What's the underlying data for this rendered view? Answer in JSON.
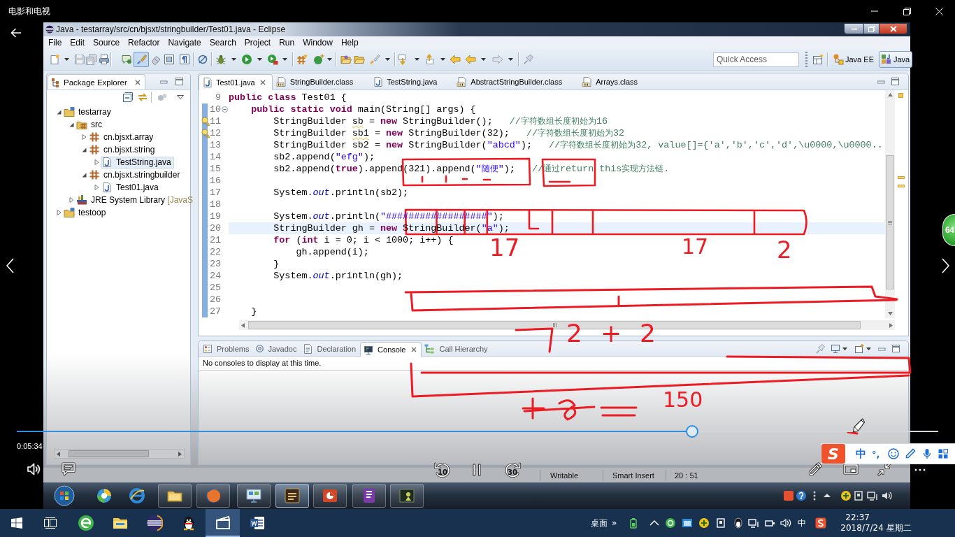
{
  "app": {
    "title": "电影和电视"
  },
  "eclipse": {
    "title": "Java - testarray/src/cn/bjsxt/stringbuilder/Test01.java - Eclipse",
    "menu": [
      "File",
      "Edit",
      "Source",
      "Refactor",
      "Navigate",
      "Search",
      "Project",
      "Run",
      "Window",
      "Help"
    ],
    "toolbar": {
      "toggle": {
        "pressed": true
      },
      "quick_access": {
        "placeholder": "Quick Access"
      },
      "perspectives": [
        {
          "label": "Java EE",
          "selected": false
        },
        {
          "label": "Java",
          "selected": true
        }
      ]
    },
    "package_explorer": {
      "title": "Package Explorer",
      "tree": [
        {
          "label": "testarray",
          "kind": "project",
          "expanded": true,
          "selected": false,
          "children": [
            {
              "label": "src",
              "kind": "source",
              "expanded": true,
              "selected": false,
              "children": [
                {
                  "label": "cn.bjsxt.array",
                  "kind": "package",
                  "expanded": false,
                  "selected": false
                },
                {
                  "label": "cn.bjsxt.string",
                  "kind": "package",
                  "expanded": true,
                  "selected": false,
                  "children": [
                    {
                      "label": "TestString.java",
                      "kind": "java",
                      "expanded": false,
                      "selected": true
                    }
                  ]
                },
                {
                  "label": "cn.bjsxt.stringbuilder",
                  "kind": "package",
                  "expanded": true,
                  "selected": false,
                  "children": [
                    {
                      "label": "Test01.java",
                      "kind": "java",
                      "expanded": false,
                      "selected": false
                    }
                  ]
                }
              ]
            },
            {
              "label": "JRE System Library",
              "note": "[JavaS",
              "kind": "library",
              "expanded": false,
              "selected": false
            }
          ]
        },
        {
          "label": "testoop",
          "kind": "project",
          "expanded": false,
          "selected": false
        }
      ]
    },
    "editor": {
      "tabs": [
        {
          "label": "Test01.java",
          "kind": "java",
          "selected": true
        },
        {
          "label": "StringBuilder.class",
          "kind": "class",
          "selected": false
        },
        {
          "label": "TestString.java",
          "kind": "java",
          "selected": false
        },
        {
          "label": "AbstractStringBuilder.class",
          "kind": "class",
          "selected": false
        },
        {
          "label": "Arrays.class",
          "kind": "class",
          "selected": false
        }
      ],
      "lines": [
        {
          "number": "9",
          "in_range": false,
          "warning": false,
          "fold_marker": false,
          "current": false,
          "code": [
            {
              "kind": "keyword",
              "text": "public class"
            },
            {
              "kind": "plain",
              "text": " Test01 {"
            }
          ]
        },
        {
          "number": "10",
          "in_range": true,
          "warning": false,
          "fold_marker": true,
          "current": false,
          "code": [
            {
              "kind": "keyword",
              "text": "    public static void"
            },
            {
              "kind": "plain",
              "text": " main(String[] args) {"
            }
          ]
        },
        {
          "number": "11",
          "in_range": true,
          "warning": true,
          "fold_marker": false,
          "current": false,
          "code": [
            {
              "kind": "plain",
              "text": "        StringBuilder "
            },
            {
              "kind": "unused",
              "text": "sb"
            },
            {
              "kind": "plain",
              "text": " = "
            },
            {
              "kind": "keyword",
              "text": "new"
            },
            {
              "kind": "plain",
              "text": " StringBuilder();   "
            },
            {
              "kind": "comment",
              "text": "//字符数组长度初始为16"
            }
          ]
        },
        {
          "number": "12",
          "in_range": true,
          "warning": true,
          "fold_marker": false,
          "current": false,
          "code": [
            {
              "kind": "plain",
              "text": "        StringBuilder "
            },
            {
              "kind": "unused",
              "text": "sb1"
            },
            {
              "kind": "plain",
              "text": " = "
            },
            {
              "kind": "keyword",
              "text": "new"
            },
            {
              "kind": "plain",
              "text": " StringBuilder(32);   "
            },
            {
              "kind": "comment",
              "text": "//字符数组长度初始为32"
            }
          ]
        },
        {
          "number": "13",
          "in_range": true,
          "warning": false,
          "fold_marker": false,
          "current": false,
          "code": [
            {
              "kind": "plain",
              "text": "        StringBuilder sb2 = "
            },
            {
              "kind": "keyword",
              "text": "new"
            },
            {
              "kind": "plain",
              "text": " StringBuilder("
            },
            {
              "kind": "string",
              "text": "\"abcd\""
            },
            {
              "kind": "plain",
              "text": ");   "
            },
            {
              "kind": "comment",
              "text": "//字符数组长度初始为32, value[]={'a','b','c','d',\\u0000,\\u0000.."
            }
          ]
        },
        {
          "number": "14",
          "in_range": true,
          "warning": false,
          "fold_marker": false,
          "current": false,
          "code": [
            {
              "kind": "plain",
              "text": "        sb2.append("
            },
            {
              "kind": "string",
              "text": "\"efg\""
            },
            {
              "kind": "plain",
              "text": ");"
            }
          ]
        },
        {
          "number": "15",
          "in_range": true,
          "warning": false,
          "fold_marker": false,
          "current": false,
          "code": [
            {
              "kind": "plain",
              "text": "        sb2.append("
            },
            {
              "kind": "keyword",
              "text": "true"
            },
            {
              "kind": "plain",
              "text": ").append(321).append("
            },
            {
              "kind": "string",
              "text": "\"随便\""
            },
            {
              "kind": "plain",
              "text": ");   "
            },
            {
              "kind": "comment",
              "text": "//通过return this实现方法链."
            }
          ]
        },
        {
          "number": "16",
          "in_range": true,
          "warning": false,
          "fold_marker": false,
          "current": false
        },
        {
          "number": "17",
          "in_range": true,
          "warning": false,
          "fold_marker": false,
          "current": false,
          "code": [
            {
              "kind": "plain",
              "text": "        System."
            },
            {
              "kind": "static_field",
              "text": "out"
            },
            {
              "kind": "plain",
              "text": ".println(sb2);"
            }
          ]
        },
        {
          "number": "18",
          "in_range": true,
          "warning": false,
          "fold_marker": false,
          "current": false
        },
        {
          "number": "19",
          "in_range": true,
          "warning": false,
          "fold_marker": false,
          "current": false,
          "code": [
            {
              "kind": "plain",
              "text": "        System."
            },
            {
              "kind": "static_field",
              "text": "out"
            },
            {
              "kind": "plain",
              "text": ".println("
            },
            {
              "kind": "string",
              "text": "\"##################\""
            },
            {
              "kind": "plain",
              "text": ");"
            }
          ]
        },
        {
          "number": "20",
          "in_range": true,
          "warning": false,
          "fold_marker": false,
          "current": true,
          "code": [
            {
              "kind": "plain",
              "text": "        StringBuilder gh = "
            },
            {
              "kind": "keyword",
              "text": "new"
            },
            {
              "kind": "plain",
              "text": " StringBuilder("
            },
            {
              "kind": "string",
              "text": "\"a\""
            },
            {
              "kind": "plain",
              "text": ");"
            }
          ]
        },
        {
          "number": "21",
          "in_range": true,
          "warning": false,
          "fold_marker": false,
          "current": false,
          "code": [
            {
              "kind": "keyword",
              "text": "        for"
            },
            {
              "kind": "plain",
              "text": " ("
            },
            {
              "kind": "keyword",
              "text": "int"
            },
            {
              "kind": "plain",
              "text": " i = 0; i < 1000; i++) {"
            }
          ]
        },
        {
          "number": "22",
          "in_range": true,
          "warning": false,
          "fold_marker": false,
          "current": false,
          "code": [
            {
              "kind": "plain",
              "text": "            gh.append(i);"
            }
          ]
        },
        {
          "number": "23",
          "in_range": true,
          "warning": false,
          "fold_marker": false,
          "current": false,
          "code": [
            {
              "kind": "plain",
              "text": "        }"
            }
          ]
        },
        {
          "number": "24",
          "in_range": true,
          "warning": false,
          "fold_marker": false,
          "current": false,
          "code": [
            {
              "kind": "plain",
              "text": "        System."
            },
            {
              "kind": "static_field",
              "text": "out"
            },
            {
              "kind": "plain",
              "text": ".println(gh);"
            }
          ]
        },
        {
          "number": "25",
          "in_range": true,
          "warning": false,
          "fold_marker": false,
          "current": false
        },
        {
          "number": "26",
          "in_range": true,
          "warning": false,
          "fold_marker": false,
          "current": false
        },
        {
          "number": "27",
          "in_range": true,
          "warning": false,
          "fold_marker": false,
          "current": false,
          "code": [
            {
              "kind": "plain",
              "text": "    }"
            }
          ]
        }
      ]
    },
    "console": {
      "tabs": [
        {
          "label": "Problems",
          "kind": "problems",
          "selected": false
        },
        {
          "label": "Javadoc",
          "kind": "javadoc",
          "selected": false
        },
        {
          "label": "Declaration",
          "kind": "declaration",
          "selected": false
        },
        {
          "label": "Console",
          "kind": "console",
          "selected": true
        },
        {
          "label": "Call Hierarchy",
          "kind": "hierarchy",
          "selected": false
        }
      ],
      "message": "No consoles to display at this time."
    },
    "status_bar": [
      "Writable",
      "Smart Insert",
      "20 : 51"
    ]
  },
  "recorded_taskbar": {
    "apps": [
      {
        "kind": "safeguard",
        "running": false,
        "selected": false
      },
      {
        "kind": "ie",
        "running": false,
        "selected": false
      },
      {
        "kind": "explorer",
        "running": true,
        "selected": false
      },
      {
        "kind": "firefox",
        "running": true,
        "selected": false
      },
      {
        "kind": "remote",
        "running": true,
        "selected": false
      },
      {
        "kind": "javaee",
        "running": true,
        "selected": true
      },
      {
        "kind": "powerpoint",
        "running": true,
        "selected": false
      },
      {
        "kind": "onenote",
        "running": true,
        "selected": false
      },
      {
        "kind": "tool",
        "running": true,
        "selected": false
      }
    ]
  },
  "annotations": [
    {
      "text": "17"
    },
    {
      "text": "17"
    },
    {
      "text": "2"
    },
    {
      "text": "2+2"
    },
    {
      "text": "150"
    }
  ],
  "player": {
    "playing": true,
    "progress": {
      "level": 0.733
    },
    "elapsed": "0:05:34",
    "rewind": "10",
    "forward": "30"
  },
  "floating_ball": {
    "text": "64"
  },
  "ime_bar": {
    "logo": "S",
    "mode": "中",
    "punctuation": "°,"
  },
  "taskbar": {
    "apps": [
      {
        "kind": "browser",
        "selected": false
      },
      {
        "kind": "explorer",
        "selected": false
      },
      {
        "kind": "ide",
        "selected": false
      },
      {
        "kind": "chat",
        "selected": false
      },
      {
        "kind": "movies",
        "selected": true
      },
      {
        "kind": "word",
        "selected": false
      }
    ],
    "toolbar_label": "桌面",
    "overflow": "»",
    "ime": "中",
    "time": "22:37",
    "date": "2018/7/24 星期二"
  }
}
